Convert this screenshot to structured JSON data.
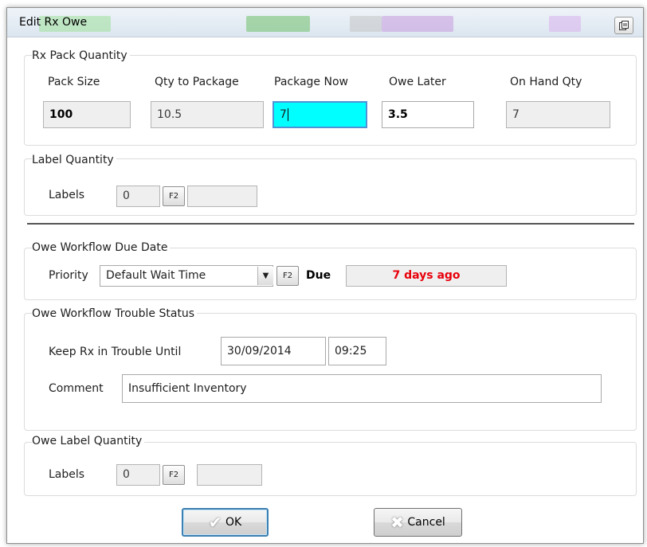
{
  "window": {
    "title": "Edit Rx Owe",
    "restore_icon": "restore-icon"
  },
  "rx_pack": {
    "group_title": "Rx Pack Quantity",
    "pack_size_label": "Pack Size",
    "pack_size_value": "100",
    "qty_to_package_label": "Qty to Package",
    "qty_to_package_value": "10.5",
    "package_now_label": "Package Now",
    "package_now_value": "7",
    "owe_later_label": "Owe Later",
    "owe_later_value": "3.5",
    "on_hand_label": "On Hand Qty",
    "on_hand_value": "7"
  },
  "label_quantity": {
    "group_title": "Label Quantity",
    "labels_label": "Labels",
    "labels_value": "0",
    "f2_label": "F2",
    "extra_value": ""
  },
  "due_date": {
    "group_title": "Owe Workflow Due Date",
    "priority_label": "Priority",
    "priority_selected": "Default Wait Time",
    "f2_label": "F2",
    "due_label": "Due",
    "due_value": "7 days ago",
    "due_color": "#e8000b"
  },
  "trouble": {
    "group_title": "Owe Workflow Trouble Status",
    "keep_label": "Keep Rx in Trouble Until",
    "date_value": "30/09/2014",
    "time_value": "09:25",
    "comment_label": "Comment",
    "comment_value": "Insufficient Inventory"
  },
  "owe_label_quantity": {
    "group_title": "Owe Label Quantity",
    "labels_label": "Labels",
    "labels_value": "0",
    "f2_label": "F2",
    "extra_value": ""
  },
  "buttons": {
    "ok_label": "OK",
    "cancel_label": "Cancel"
  },
  "colors": {
    "package_now_bg": "#00ffff",
    "focus_border": "#4f93d6",
    "default_button_border": "#3c7fb1"
  }
}
